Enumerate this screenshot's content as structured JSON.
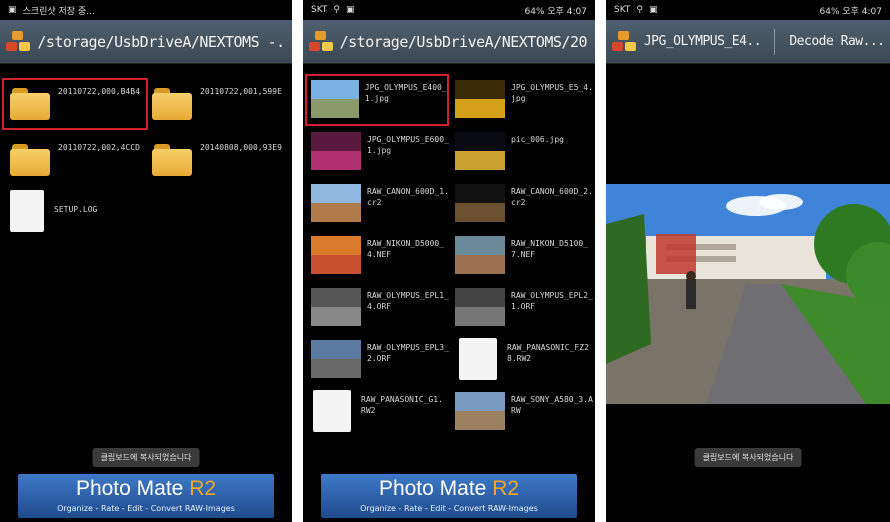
{
  "phone1": {
    "status_text": "스크린샷 저장 중...",
    "path": "/storage/UsbDriveA/NEXTOMS -..",
    "items": [
      {
        "label": "20110722,000,B4B4",
        "type": "folder"
      },
      {
        "label": "20110722,001,599E",
        "type": "folder"
      },
      {
        "label": "20110722,002,4CCD",
        "type": "folder"
      },
      {
        "label": "20140808,000,93E9",
        "type": "folder"
      },
      {
        "label": "SETUP.LOG",
        "type": "file"
      }
    ],
    "toast": "클립보드에 복사되었습니다",
    "banner_title": "Photo Mate",
    "banner_r2": "R2",
    "banner_sub": "Organize - Rate - Edit - Convert RAW-Images"
  },
  "phone2": {
    "status_left": "SKT",
    "status_right": "64% 오후 4:07",
    "path": "/storage/UsbDriveA/NEXTOMS/20..",
    "items": [
      {
        "label": "JPG_OLYMPUS_E400_1.jpg"
      },
      {
        "label": "JPG_OLYMPUS_E5_4.jpg"
      },
      {
        "label": "JPG_OLYMPUS_E600_1.jpg"
      },
      {
        "label": "pic_006.jpg"
      },
      {
        "label": "RAW_CANON_600D_1.cr2"
      },
      {
        "label": "RAW_CANON_600D_2.cr2"
      },
      {
        "label": "RAW_NIKON_D5000_4.NEF"
      },
      {
        "label": "RAW_NIKON_D5100_7.NEF"
      },
      {
        "label": "RAW_OLYMPUS_EPL1_4.ORF"
      },
      {
        "label": "RAW_OLYMPUS_EPL2_1.ORF"
      },
      {
        "label": "RAW_OLYMPUS_EPL3_2.ORF"
      },
      {
        "label": "RAW_PANASONIC_FZ28.RW2"
      },
      {
        "label": "RAW_PANASONIC_G1.RW2"
      },
      {
        "label": "RAW_SONY_A580_3.ARW"
      }
    ],
    "banner_title": "Photo Mate",
    "banner_r2": "R2",
    "banner_sub": "Organize - Rate - Edit - Convert RAW-Images"
  },
  "phone3": {
    "status_left": "SKT",
    "status_right": "64% 오후 4:07",
    "title": "JPG_OLYMPUS_E4..",
    "action": "Decode Raw...",
    "toast": "클립보드에 복사되었습니다"
  }
}
